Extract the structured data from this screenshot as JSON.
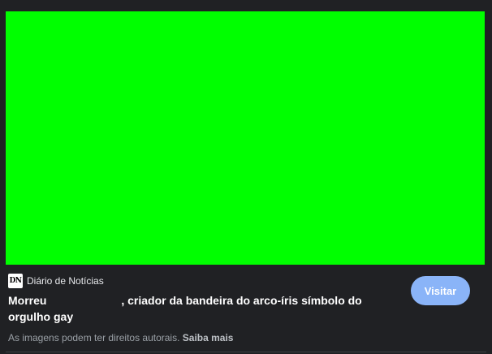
{
  "image": {
    "fill_color": "#00ff00"
  },
  "source": {
    "logo_text": "DN",
    "name": "Diário de Notícias"
  },
  "article": {
    "title_part1": "Morreu ",
    "title_part2": ", criador da bandeira do arco-íris símbolo do orgulho gay"
  },
  "visit_button": {
    "label": "Visitar",
    "color": "#8ab4f8"
  },
  "copyright": {
    "notice": "As imagens podem ter direitos autorais.",
    "learn_more": "Saiba mais"
  }
}
